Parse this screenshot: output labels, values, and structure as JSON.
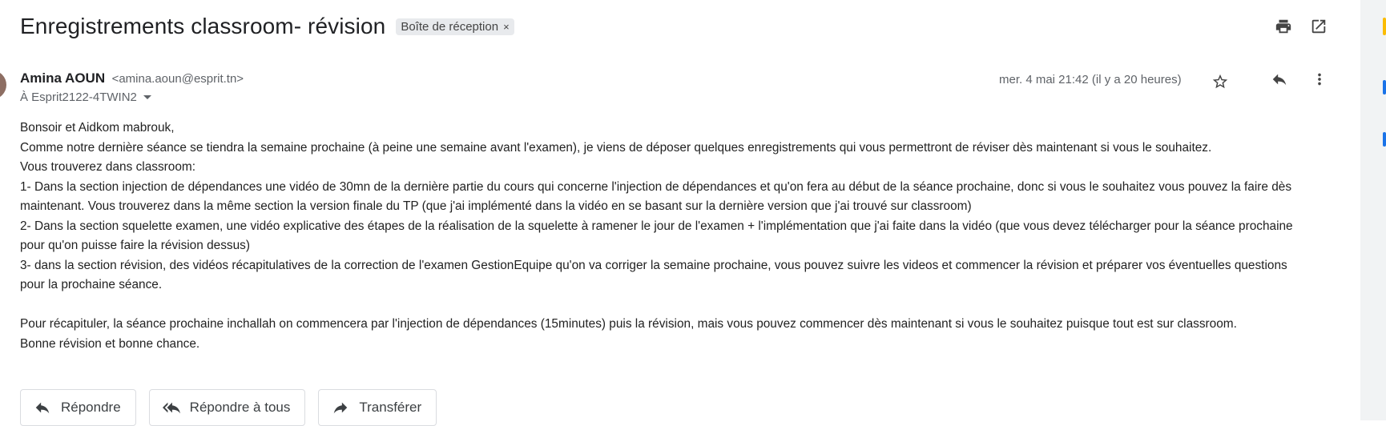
{
  "email": {
    "subject": "Enregistrements classroom- révision",
    "label": "Boîte de réception",
    "label_close": "×",
    "sender_name": "Amina AOUN",
    "sender_email": "<amina.aoun@esprit.tn>",
    "recipient": "À Esprit2122-4TWIN2",
    "date": "mer. 4 mai 21:42 (il y a 20 heures)",
    "body": [
      "Bonsoir et Aidkom mabrouk,",
      "Comme notre dernière séance se tiendra la semaine prochaine (à peine une semaine avant l'examen), je viens de déposer quelques enregistrements qui vous permettront de réviser dès maintenant si vous le souhaitez.",
      "Vous trouverez dans classroom:",
      "1- Dans la section injection de dépendances une vidéo de 30mn de la dernière partie du cours qui concerne l'injection de dépendances et qu'on fera au début de la séance prochaine, donc si vous le souhaitez vous pouvez la faire dès maintenant. Vous trouverez dans la même section la version finale du TP (que j'ai implémenté dans la vidéo en se basant sur la dernière version que j'ai trouvé sur classroom)",
      "2- Dans la section squelette examen, une vidéo explicative des étapes de la réalisation de la squelette à ramener le jour de l'examen + l'implémentation que j'ai faite dans la vidéo (que vous devez télécharger pour la séance prochaine pour qu'on puisse faire la révision dessus)",
      "3- dans la section révision, des vidéos récapitulatives de la correction de l'examen GestionEquipe qu'on va corriger la semaine prochaine, vous pouvez suivre les videos et commencer la révision et préparer vos éventuelles questions pour la prochaine séance.",
      "",
      "Pour récapituler, la séance prochaine inchallah on commencera par l'injection de dépendances (15minutes) puis la révision, mais vous pouvez commencer dès maintenant si vous le souhaitez puisque tout est sur classroom.",
      "Bonne révision et bonne chance."
    ]
  },
  "actions": {
    "reply": "Répondre",
    "reply_all": "Répondre à tous",
    "forward": "Transférer"
  },
  "icons": {
    "print": "print-icon",
    "open_new_window": "open-in-new-window-icon",
    "star": "star-icon",
    "reply": "reply-icon",
    "more": "more-vert-icon",
    "reply_all": "reply-all-icon",
    "forward": "forward-icon"
  },
  "colors": {
    "text": "#202124",
    "muted": "#5f6368",
    "chip_bg": "#e8eaed",
    "rail_bg": "#f1f3f4"
  }
}
